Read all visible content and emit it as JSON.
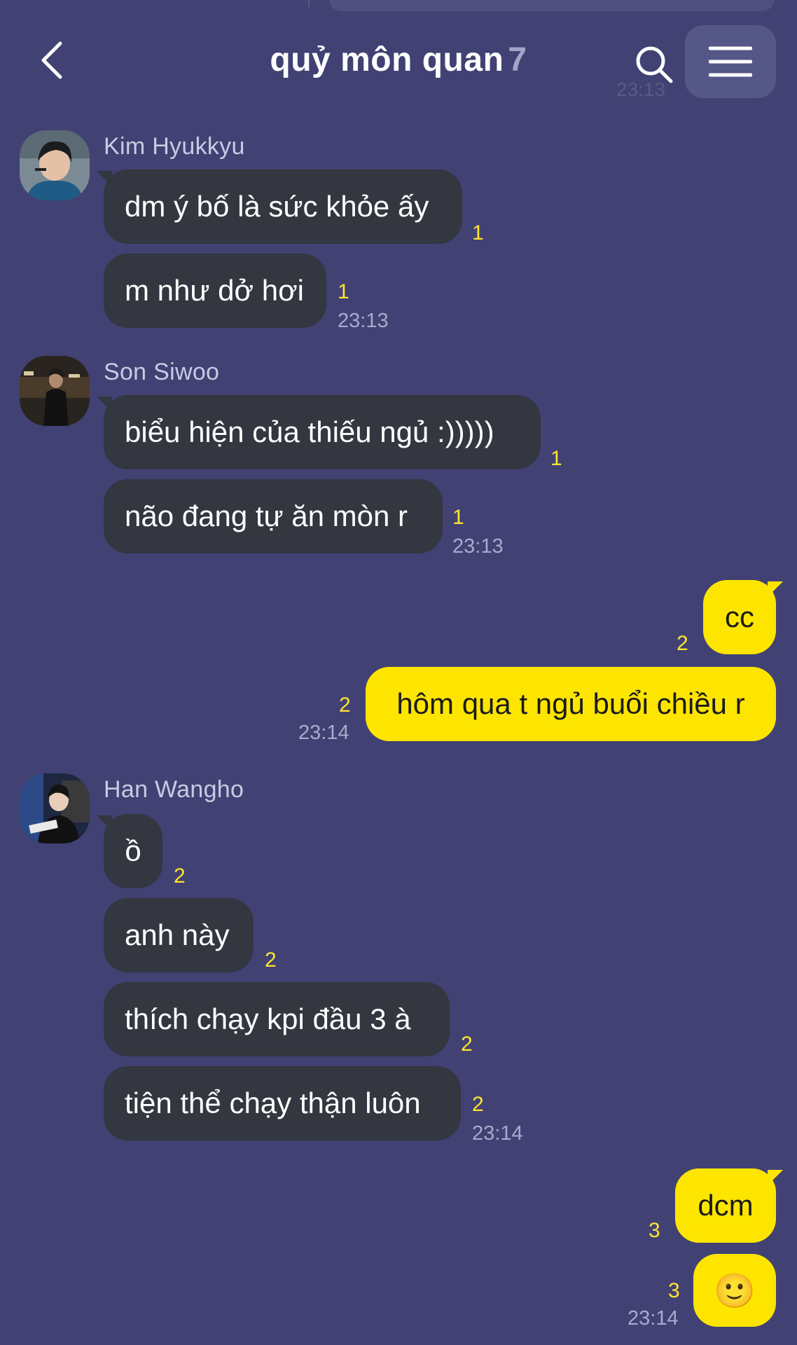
{
  "header": {
    "title": "quỷ môn quan",
    "member_count": "7"
  },
  "ghost_time": "23:13",
  "messages": {
    "kim": {
      "sender": "Kim Hyukkyu",
      "m1": "dm ý bố là sức khỏe ấy",
      "m1_read": "1",
      "m2": "m như dở hơi",
      "m2_read": "1",
      "time": "23:13"
    },
    "son": {
      "sender": "Son Siwoo",
      "m1": "biểu hiện của thiếu ngủ :)))))",
      "m1_read": "1",
      "m2": "não đang tự ăn mòn r",
      "m2_read": "1",
      "time": "23:13"
    },
    "me1": {
      "m1": "cc",
      "m1_read": "2",
      "m2": "hôm qua t ngủ buổi chiều r",
      "m2_read": "2",
      "time": "23:14"
    },
    "han": {
      "sender": "Han Wangho",
      "m1": "ồ",
      "m1_read": "2",
      "m2": "anh này",
      "m2_read": "2",
      "m3": "thích chạy kpi đầu 3 à",
      "m3_read": "2",
      "m4": "tiện thể chạy thận luôn",
      "m4_read": "2",
      "time": "23:14"
    },
    "me2": {
      "m1": "dcm",
      "m1_read": "3",
      "m2": "🙂",
      "m2_read": "3",
      "time": "23:14"
    }
  },
  "icons": {
    "back": "chevron-left-icon",
    "search": "search-icon",
    "menu": "hamburger-menu-icon"
  },
  "colors": {
    "background": "#414273",
    "incoming_bubble": "#343640",
    "outgoing_bubble": "#fee500",
    "read_count": "#ffe330"
  }
}
